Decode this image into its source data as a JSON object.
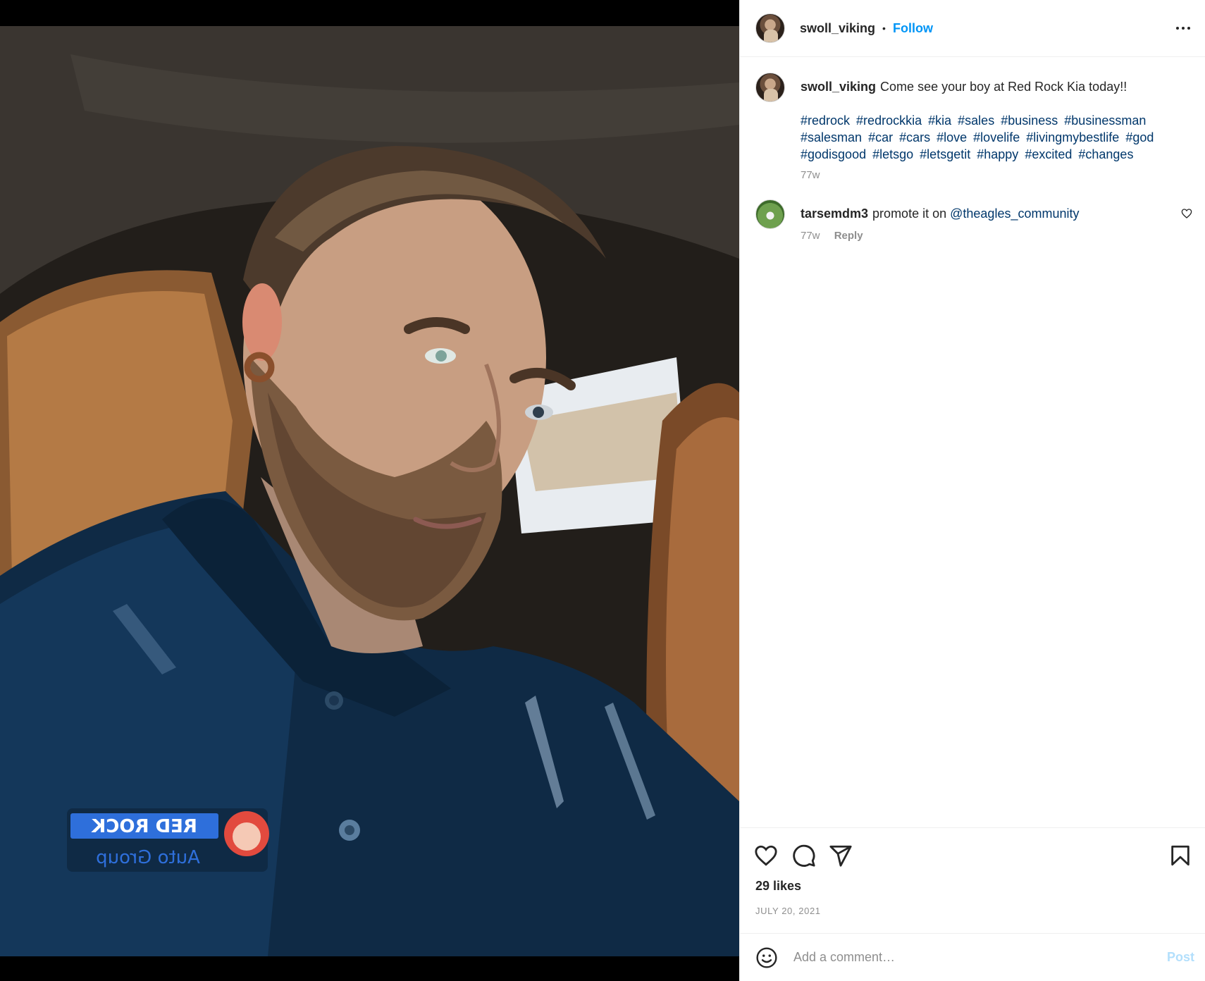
{
  "post": {
    "username": "swoll_viking",
    "separator": "•",
    "follow_label": "Follow",
    "more_icon": "more-horizontal-icon",
    "photo_logo_text_line1": "RED ROCK",
    "photo_logo_text_line2": "Auto Group"
  },
  "caption": {
    "username": "swoll_viking",
    "text": "Come see your boy at Red Rock Kia today!!",
    "hashtags": [
      "#redrock",
      "#redrockkia",
      "#kia",
      "#sales",
      "#business",
      "#businessman",
      "#salesman",
      "#car",
      "#cars",
      "#love",
      "#lovelife",
      "#livingmybestlife",
      "#god",
      "#godisgood",
      "#letsgo",
      "#letsgetit",
      "#happy",
      "#excited",
      "#changes"
    ],
    "age": "77w"
  },
  "comments": [
    {
      "username": "tarsemdm3",
      "text": "promote it on",
      "mention": "@theagles_community",
      "age": "77w",
      "reply_label": "Reply"
    }
  ],
  "actions": {
    "like_icon": "heart-icon",
    "comment_icon": "comment-icon",
    "share_icon": "send-icon",
    "save_icon": "bookmark-icon",
    "likes": "29 likes",
    "date": "JULY 20, 2021"
  },
  "add_comment": {
    "emoji_icon": "smiley-icon",
    "placeholder": "Add a comment…",
    "post_label": "Post"
  },
  "colors": {
    "link_blue": "#0095f6",
    "hashtag_blue": "#00376b",
    "muted_gray": "#8e8e8e",
    "disabled_post": "#b2dffc"
  }
}
